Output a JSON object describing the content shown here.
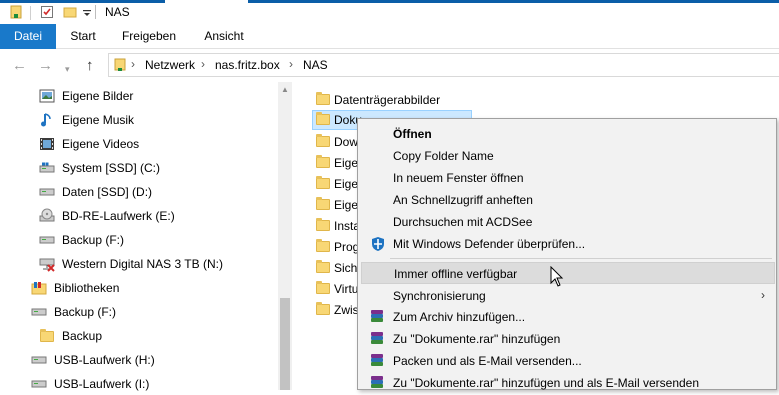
{
  "window": {
    "title": "NAS"
  },
  "ribbon": {
    "tabs": [
      "Datei",
      "Start",
      "Freigeben",
      "Ansicht"
    ]
  },
  "address": {
    "crumbs": [
      "Netzwerk",
      "nas.fritz.box",
      "NAS"
    ]
  },
  "nav": {
    "items": [
      {
        "label": "Eigene Bilder",
        "icon": "pictures-icon"
      },
      {
        "label": "Eigene Musik",
        "icon": "music-icon"
      },
      {
        "label": "Eigene Videos",
        "icon": "videos-icon"
      },
      {
        "label": "System [SSD] (C:)",
        "icon": "system-drive-icon"
      },
      {
        "label": "Daten [SSD] (D:)",
        "icon": "drive-icon"
      },
      {
        "label": "BD-RE-Laufwerk (E:)",
        "icon": "optical-drive-icon"
      },
      {
        "label": "Backup (F:)",
        "icon": "drive-icon"
      },
      {
        "label": "Western Digital NAS 3 TB (N:)",
        "icon": "disconnected-network-drive-icon"
      },
      {
        "label": "Bibliotheken",
        "icon": "libraries-icon"
      },
      {
        "label": "Backup (F:)",
        "icon": "drive-icon"
      },
      {
        "label": "Backup",
        "icon": "folder-icon"
      },
      {
        "label": "USB-Laufwerk (H:)",
        "icon": "drive-icon"
      },
      {
        "label": "USB-Laufwerk (I:)",
        "icon": "drive-icon"
      }
    ]
  },
  "content": {
    "folders": [
      "Datenträgerabbilder",
      "Doku",
      "Dow",
      "Eige",
      "Eige",
      "Eige",
      "Insta",
      "Prog",
      "Sich",
      "Virtu",
      "Zwis"
    ]
  },
  "context_menu": {
    "items": [
      {
        "label": "Öffnen",
        "bold": true
      },
      {
        "label": "Copy Folder Name"
      },
      {
        "label": "In neuem Fenster öffnen"
      },
      {
        "label": "An Schnellzugriff anheften"
      },
      {
        "label": "Durchsuchen mit ACDSee"
      },
      {
        "label": "Mit Windows Defender überprüfen...",
        "icon": "windows-defender-icon"
      },
      {
        "label": "Immer offline verfügbar",
        "hover": true
      },
      {
        "label": "Synchronisierung",
        "submenu": true
      },
      {
        "label": "Zum Archiv hinzufügen...",
        "icon": "winrar-icon"
      },
      {
        "label": "Zu \"Dokumente.rar\" hinzufügen",
        "icon": "winrar-icon"
      },
      {
        "label": "Packen und als E-Mail versenden...",
        "icon": "winrar-icon"
      },
      {
        "label": "Zu \"Dokumente.rar\" hinzufügen und als E-Mail versenden",
        "icon": "winrar-icon"
      }
    ]
  },
  "colors": {
    "accent": "#1979ca",
    "selection": "#cce8ff",
    "menu_bg": "#f2f2f2"
  }
}
